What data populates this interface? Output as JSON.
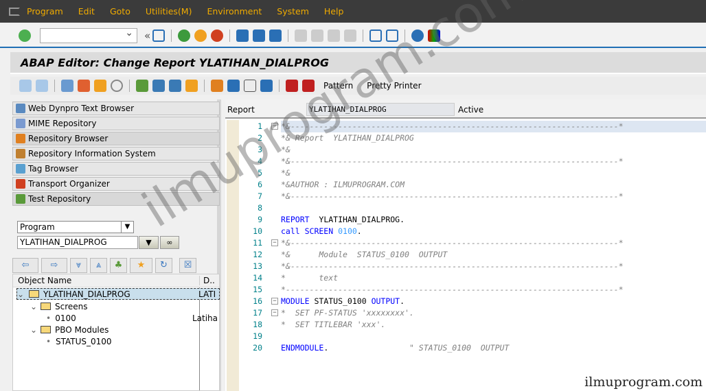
{
  "menu": [
    "Program",
    "Edit",
    "Goto",
    "Utilities(M)",
    "Environment",
    "System",
    "Help"
  ],
  "title": "ABAP Editor: Change Report YLATIHAN_DIALPROG",
  "app_toolbar": {
    "pattern": "Pattern",
    "pretty_printer": "Pretty Printer"
  },
  "nav": [
    "Web Dynpro Text Browser",
    "MIME Repository",
    "Repository Browser",
    "Repository Information System",
    "Tag Browser",
    "Transport Organizer",
    "Test Repository"
  ],
  "object_type": "Program",
  "object_name": "YLATIHAN_DIALPROG",
  "tree": {
    "col1": "Object Name",
    "col2": "D..",
    "rows": [
      {
        "label": "YLATIHAN_DIALPROG",
        "desc": "LATI"
      },
      {
        "label": "Screens",
        "desc": ""
      },
      {
        "label": "0100",
        "desc": "Latiha"
      },
      {
        "label": "PBO Modules",
        "desc": ""
      },
      {
        "label": "STATUS_0100",
        "desc": ""
      }
    ]
  },
  "editor": {
    "type_label": "Report",
    "program": "YLATIHAN_DIALPROG",
    "status": "Active",
    "lines": [
      [
        [
          "*&---------------------------------------------------------------------*",
          "cm"
        ]
      ],
      [
        [
          "*& Report  YLATIHAN_DIALPROG",
          "cm"
        ]
      ],
      [
        [
          "*&",
          "cm"
        ]
      ],
      [
        [
          "*&---------------------------------------------------------------------*",
          "cm"
        ]
      ],
      [
        [
          "*&",
          "cm"
        ]
      ],
      [
        [
          "*&AUTHOR : ILMUPROGRAM.COM",
          "cm"
        ]
      ],
      [
        [
          "*&---------------------------------------------------------------------*",
          "cm"
        ]
      ],
      [],
      [
        [
          "REPORT",
          "kw"
        ],
        [
          "  YLATIHAN_DIALPROG.",
          "id"
        ]
      ],
      [
        [
          "call SCREEN ",
          "kw"
        ],
        [
          "0100",
          "num"
        ],
        [
          ".",
          "id"
        ]
      ],
      [
        [
          "*&---------------------------------------------------------------------*",
          "cm"
        ]
      ],
      [
        [
          "*&      Module  STATUS_0100  OUTPUT",
          "cm"
        ]
      ],
      [
        [
          "*&---------------------------------------------------------------------*",
          "cm"
        ]
      ],
      [
        [
          "*       text",
          "cm"
        ]
      ],
      [
        [
          "*----------------------------------------------------------------------*",
          "cm"
        ]
      ],
      [
        [
          "MODULE",
          "kw"
        ],
        [
          " STATUS_0100 ",
          "id"
        ],
        [
          "OUTPUT",
          "kw"
        ],
        [
          ".",
          "id"
        ]
      ],
      [
        [
          "*  SET PF-STATUS 'xxxxxxxx'.",
          "cm"
        ]
      ],
      [
        [
          "*  SET TITLEBAR 'xxx'.",
          "cm"
        ]
      ],
      [],
      [
        [
          "ENDMODULE",
          "kw"
        ],
        [
          ".",
          "id"
        ],
        [
          "                 \" STATUS_0100  OUTPUT",
          "cm"
        ]
      ]
    ]
  },
  "watermark": "ilmuprogram.com",
  "watermark_footer": "ilmuprogram.com"
}
